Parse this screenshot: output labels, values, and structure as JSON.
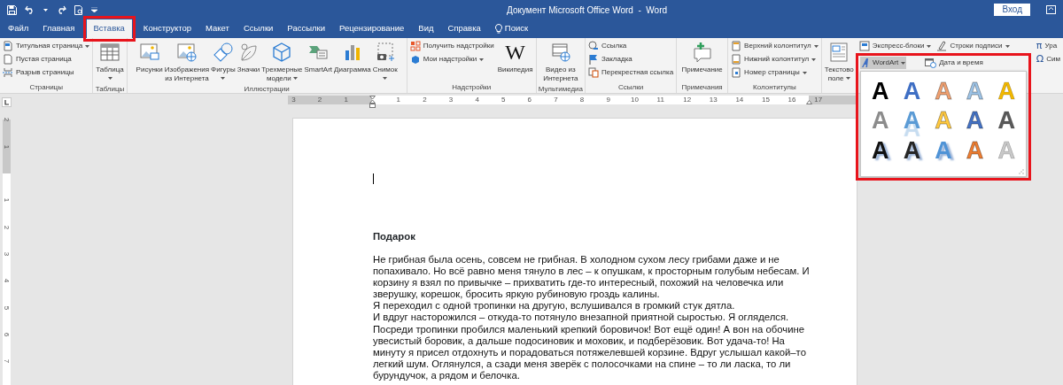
{
  "window": {
    "title": "Документ Microsoft Office Word  -  Word",
    "sign_in": "Вход"
  },
  "tabs": [
    {
      "label": "Файл",
      "selected": false,
      "highlighted": false,
      "kind": "tab"
    },
    {
      "label": "Главная",
      "selected": false,
      "highlighted": false,
      "kind": "tab"
    },
    {
      "label": "Вставка",
      "selected": true,
      "highlighted": true,
      "kind": "tab"
    },
    {
      "label": "Конструктор",
      "selected": false,
      "highlighted": false,
      "kind": "tab"
    },
    {
      "label": "Макет",
      "selected": false,
      "highlighted": false,
      "kind": "tab"
    },
    {
      "label": "Ссылки",
      "selected": false,
      "highlighted": false,
      "kind": "tab"
    },
    {
      "label": "Рассылки",
      "selected": false,
      "highlighted": false,
      "kind": "tab"
    },
    {
      "label": "Рецензирование",
      "selected": false,
      "highlighted": false,
      "kind": "tab"
    },
    {
      "label": "Вид",
      "selected": false,
      "highlighted": false,
      "kind": "tab"
    },
    {
      "label": "Справка",
      "selected": false,
      "highlighted": false,
      "kind": "tab"
    },
    {
      "label": "Поиск",
      "selected": false,
      "highlighted": false,
      "kind": "search"
    }
  ],
  "ribbon": {
    "groups": [
      {
        "label": "Страницы",
        "items": [
          {
            "kind": "stack",
            "items": [
              {
                "label": "Титульная страница",
                "dropdown": true
              },
              {
                "label": "Пустая страница",
                "dropdown": false
              },
              {
                "label": "Разрыв страницы",
                "dropdown": false
              }
            ]
          }
        ]
      },
      {
        "label": "Таблицы",
        "items": [
          {
            "kind": "large",
            "lines": [
              "Таблица"
            ],
            "dropdown": true
          }
        ]
      },
      {
        "label": "Иллюстрации",
        "items": [
          {
            "kind": "large",
            "lines": [
              "Рисунки"
            ],
            "dropdown": false
          },
          {
            "kind": "large",
            "lines": [
              "Изображения",
              "из Интернета"
            ],
            "dropdown": false
          },
          {
            "kind": "large",
            "lines": [
              "Фигуры"
            ],
            "dropdown": true
          },
          {
            "kind": "large",
            "lines": [
              "Значки"
            ],
            "dropdown": false
          },
          {
            "kind": "large",
            "lines": [
              "Трехмерные",
              "модели"
            ],
            "dropdown": true
          },
          {
            "kind": "large",
            "lines": [
              "SmartArt"
            ],
            "dropdown": false
          },
          {
            "kind": "large",
            "lines": [
              "Диаграмма"
            ],
            "dropdown": false
          },
          {
            "kind": "large",
            "lines": [
              "Снимок"
            ],
            "dropdown": true
          }
        ]
      },
      {
        "label": "Надстройки",
        "items": [
          {
            "kind": "stack",
            "items": [
              {
                "label": "Получить надстройки",
                "dropdown": false
              },
              {
                "label": "Мои надстройки",
                "dropdown": true
              }
            ]
          },
          {
            "kind": "large",
            "glyph": "W",
            "lines": [
              "Википедия"
            ],
            "dropdown": false
          }
        ]
      },
      {
        "label": "Мультимедиа",
        "items": [
          {
            "kind": "large",
            "lines": [
              "Видео из",
              "Интернета"
            ],
            "dropdown": false
          }
        ]
      },
      {
        "label": "Ссылки",
        "items": [
          {
            "kind": "stack",
            "items": [
              {
                "label": "Ссылка",
                "dropdown": false
              },
              {
                "label": "Закладка",
                "dropdown": false
              },
              {
                "label": "Перекрестная ссылка",
                "dropdown": false
              }
            ]
          }
        ]
      },
      {
        "label": "Примечания",
        "items": [
          {
            "kind": "large",
            "lines": [
              "Примечание"
            ],
            "dropdown": false
          }
        ]
      },
      {
        "label": "Колонтитулы",
        "items": [
          {
            "kind": "stack",
            "items": [
              {
                "label": "Верхний колонтитул",
                "dropdown": true
              },
              {
                "label": "Нижний колонтитул",
                "dropdown": true
              },
              {
                "label": "Номер страницы",
                "dropdown": true
              }
            ]
          }
        ]
      },
      {
        "items": [
          {
            "kind": "large",
            "lines": [
              "Текстово",
              "поле"
            ],
            "dropdown": true
          },
          {
            "kind": "stack",
            "items": [
              {
                "label": "Экспресс-блоки",
                "dropdown": true
              }
            ]
          },
          {
            "kind": "stack",
            "items": [
              {
                "label": "Строки подписи",
                "dropdown": true
              }
            ]
          }
        ]
      },
      {
        "items": [
          {
            "kind": "stack",
            "items": [
              {
                "glyph": "π",
                "label": "Ура",
                "dropdown": false
              },
              {
                "glyph": "Ω",
                "label": "Сим",
                "dropdown": false
              }
            ]
          }
        ]
      }
    ]
  },
  "gallery": {
    "highlighted": true,
    "header": [
      {
        "label": "WordArt",
        "dropdown": true,
        "pressed": true
      },
      {
        "label": "Дата и время",
        "dropdown": false,
        "pressed": false
      }
    ],
    "styles": [
      {
        "text": "A",
        "kind": "fill",
        "color": "#000000"
      },
      {
        "text": "A",
        "kind": "fill",
        "color": "#3f6fc4"
      },
      {
        "text": "A",
        "kind": "outline",
        "color": "#f0a070"
      },
      {
        "text": "A",
        "kind": "outline",
        "color": "#9dc3e6"
      },
      {
        "text": "A",
        "kind": "gradient",
        "color": "#f2b800"
      },
      {
        "text": "A",
        "kind": "fill",
        "color": "#8c8c8c"
      },
      {
        "text": "A",
        "kind": "reflection",
        "color": "#5b9bd5"
      },
      {
        "text": "A",
        "kind": "outline",
        "color": "#ffc940"
      },
      {
        "text": "A",
        "kind": "outline",
        "color": "#4472c4"
      },
      {
        "text": "A",
        "kind": "gradient",
        "color": "#595959"
      },
      {
        "text": "A",
        "kind": "shadow",
        "color": "#111111"
      },
      {
        "text": "A",
        "kind": "shadow",
        "color": "#262626"
      },
      {
        "text": "A",
        "kind": "shadow",
        "color": "#4f93d6"
      },
      {
        "text": "A",
        "kind": "outline",
        "color": "#ed7d31"
      },
      {
        "text": "A",
        "kind": "gradient",
        "color": "#c8c8c8"
      }
    ]
  },
  "ruler": {
    "before": [
      "3",
      "2",
      "1"
    ],
    "after": [
      "1",
      "2",
      "3",
      "4",
      "5",
      "6",
      "7",
      "8",
      "9",
      "10",
      "11",
      "12",
      "13",
      "14",
      "15",
      "16",
      "17"
    ]
  },
  "vertical_ruler": {
    "before": [
      "2",
      "1"
    ],
    "after": [
      "1",
      "2",
      "3",
      "4",
      "5",
      "6",
      "7"
    ]
  },
  "document": {
    "heading": "Подарок",
    "paragraphs": [
      [
        "Не грибная была осень, совсем не грибная. В холодном сухом лесу грибами даже и не",
        "попахивало. Но всё равно меня тянуло в лес – к опушкам, к просторным голубым небесам. И",
        "корзину я взял по привычке – прихватить где-то интересный, похожий на человечка или",
        "зверушку, корешок, бросить яркую рубиновую гроздь калины."
      ],
      [
        "Я переходил с одной тропинки на другую, вслушивался в громкий стук дятла."
      ],
      [
        "И вдруг насторожился – откуда-то потянуло внезапной приятной сыростью. Я огляделся.",
        "Посреди тропинки пробился маленький крепкий боровичок! Вот ещё один! А вон на обочине",
        "увесистый боровик, а дальше подосиновик и моховик, и подберёзовик. Вот удача-то! На",
        "минуту я присел отдохнуть и порадоваться потяжелевшей корзине. Вдруг услышал какой–то",
        "легкий шум. Оглянулся, а сзади меня зверёк с полосочками на спине – то ли ласка, то ли",
        "бурундучок, а рядом и белочка."
      ]
    ]
  }
}
